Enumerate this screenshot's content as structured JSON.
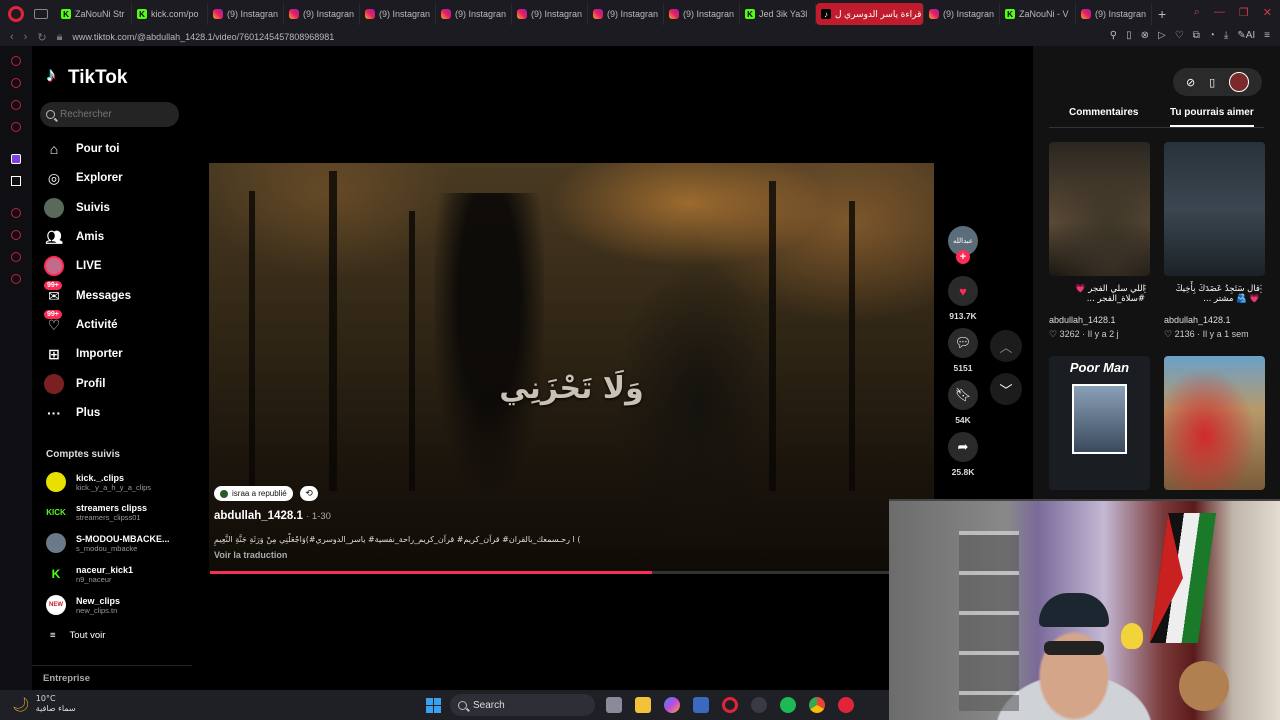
{
  "browser": {
    "tabs": [
      {
        "label": "ZaNouNi Str",
        "favicon": "kick"
      },
      {
        "label": "kick.com/po",
        "favicon": "kick"
      },
      {
        "label": "(9) Instagran",
        "favicon": "instagram"
      },
      {
        "label": "(9) Instagran",
        "favicon": "instagram"
      },
      {
        "label": "(9) Instagran",
        "favicon": "instagram"
      },
      {
        "label": "(9) Instagran",
        "favicon": "instagram"
      },
      {
        "label": "(9) Instagran",
        "favicon": "instagram"
      },
      {
        "label": "(9) Instagran",
        "favicon": "instagram"
      },
      {
        "label": "(9) Instagran",
        "favicon": "instagram"
      },
      {
        "label": "Jed 3ik Ya3l",
        "favicon": "kick"
      },
      {
        "label": "قراءة ياسر الدوسري ل",
        "favicon": "tiktok",
        "active": true
      },
      {
        "label": "(9) Instagran",
        "favicon": "instagram"
      },
      {
        "label": "ZaNouNi - V",
        "favicon": "kick"
      },
      {
        "label": "(9) Instagran",
        "favicon": "instagram"
      }
    ],
    "url": "www.tiktok.com/@abdullah_1428.1/video/7601245457808968981",
    "ai_label": "AI"
  },
  "tiktok": {
    "logo_text": "TikTok",
    "search_placeholder": "Rechercher",
    "nav": [
      {
        "label": "Pour toi",
        "icon": "home-icon"
      },
      {
        "label": "Explorer",
        "icon": "compass-icon"
      },
      {
        "label": "Suivis",
        "icon": "following-avatar"
      },
      {
        "label": "Amis",
        "icon": "friends-icon"
      },
      {
        "label": "LIVE",
        "icon": "live-avatar"
      },
      {
        "label": "Messages",
        "icon": "messages-icon",
        "badge": "99+"
      },
      {
        "label": "Activité",
        "icon": "activity-icon",
        "badge": "99+"
      },
      {
        "label": "Importer",
        "icon": "upload-icon"
      },
      {
        "label": "Profil",
        "icon": "profile-avatar"
      },
      {
        "label": "Plus",
        "icon": "more-icon"
      }
    ],
    "following_title": "Comptes suivis",
    "following": [
      {
        "name": "kick._.clips",
        "handle": "kick._y_a_h_y_a_clips",
        "avatar_color": "#e8e000"
      },
      {
        "name": "streamers clipss",
        "handle": "streamers_clipss01",
        "avatar_color": "#000000",
        "avatar_text": "KICK"
      },
      {
        "name": "S-MODOU-MBACKE...",
        "handle": "s_modou_mbacke",
        "avatar_color": "#6a7a8a"
      },
      {
        "name": "naceur_kick1",
        "handle": "n9_naceur",
        "avatar_color": "#000000",
        "avatar_text": "K"
      },
      {
        "name": "New_clips",
        "handle": "new_clips.tn",
        "avatar_color": "#ffffff",
        "avatar_text": "NEW"
      }
    ],
    "see_all": "Tout voir",
    "enterprise": "Entreprise"
  },
  "video": {
    "overlay_text": "وَلَا تَحْزَنِي",
    "repost_label": "israa a republié",
    "author": "abdullah_1428.1",
    "date": "· 1-30",
    "description": "ا رحـسمعك_بالقران# قرآن_كريم# قرآن_كريم_راحة_نفسية# ياسر_الدوسري#)وَاجْعَلْنِي مِنْ وَرَثَةِ جَنَّةِ النَّعِيمِ (",
    "translate": "Voir la traduction",
    "progress": 0.65,
    "likes": "913.7K",
    "comments": "5151",
    "saves": "54K",
    "shares": "25.8K",
    "avatar_text": "عبدالله"
  },
  "right_panel": {
    "tab_comments": "Commentaires",
    "tab_suggested": "Tu pourrais aimer",
    "cards": [
      {
        "title": "اللي سلي الفجر 💗 #سلاة_الفجر ...",
        "author": "abdullah_1428.1",
        "likes": "3262",
        "age": "Il y a 2 j"
      },
      {
        "title": "قال سَتَجِدُ عَضَدَكَ بِأَخِيكَ 💗 🫂 مشتر ...",
        "author": "abdullah_1428.1",
        "likes": "2136",
        "age": "Il y a 1 sem"
      },
      {
        "title": "Poor Man"
      },
      {
        "title": ""
      }
    ]
  },
  "taskbar": {
    "temperature": "10°C",
    "weather": "سماء صافية",
    "search": "Search"
  }
}
